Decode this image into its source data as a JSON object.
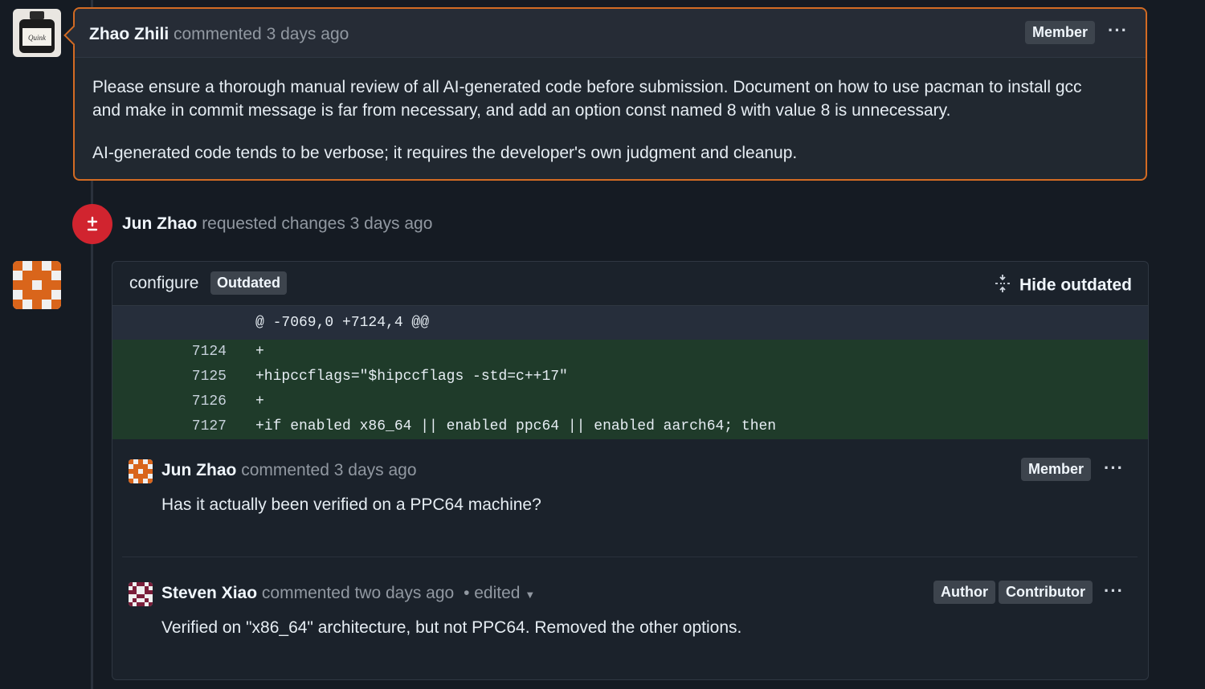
{
  "top_comment": {
    "author": "Zhao Zhili",
    "action": "commented",
    "time": "3 days ago",
    "badge": "Member",
    "body": [
      "Please ensure a thorough manual review of all AI-generated code before submission. Document on how to use pacman to install gcc and make in commit message is far from necessary, and add an option const named 8 with value 8 is unnecessary.",
      "AI-generated code tends to be verbose; it requires the developer's own judgment and cleanup."
    ],
    "avatar_label": "Quink"
  },
  "review_event": {
    "author": "Jun Zhao",
    "action": "requested changes",
    "time": "3 days ago",
    "icon": "file-diff-icon"
  },
  "thread": {
    "file": "configure",
    "outdated_badge": "Outdated",
    "hide_label": "Hide outdated",
    "hunk": "@ -7069,0 +7124,4 @@",
    "lines": [
      {
        "num": "7124",
        "code": "+"
      },
      {
        "num": "7125",
        "code": "+hipccflags=\"$hipccflags -std=c++17\""
      },
      {
        "num": "7126",
        "code": "+"
      },
      {
        "num": "7127",
        "code": "+if enabled x86_64 || enabled ppc64 || enabled aarch64; then"
      }
    ],
    "replies": [
      {
        "author": "Jun Zhao",
        "action": "commented",
        "time": "3 days ago",
        "badges": [
          "Member"
        ],
        "body": "Has it actually been verified on a PPC64 machine?"
      },
      {
        "author": "Steven Xiao",
        "action": "commented",
        "time": "two days ago",
        "edited": "• edited",
        "badges": [
          "Author",
          "Contributor"
        ],
        "body": "Verified on \"x86_64\" architecture, but not PPC64. Removed the other options."
      }
    ]
  },
  "colors": {
    "accent_border": "#d36b23",
    "request_changes": "#d1242f",
    "diff_added": "#1f3b2a"
  }
}
